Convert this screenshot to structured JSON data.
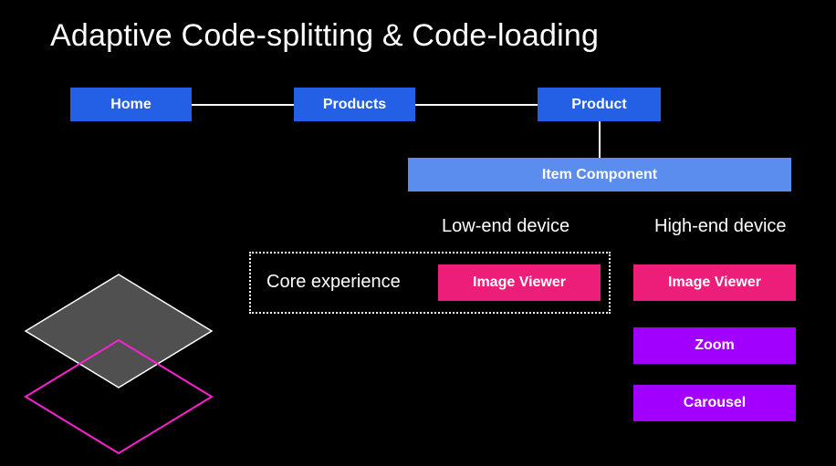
{
  "title": "Adaptive Code-splitting & Code-loading",
  "tree": {
    "home": "Home",
    "products": "Products",
    "product": "Product",
    "item": "Item Component"
  },
  "headers": {
    "low": "Low-end device",
    "high": "High-end device",
    "core": "Core experience"
  },
  "modules": {
    "low_viewer": "Image Viewer",
    "high_viewer": "Image Viewer",
    "zoom": "Zoom",
    "carousel": "Carousel"
  }
}
